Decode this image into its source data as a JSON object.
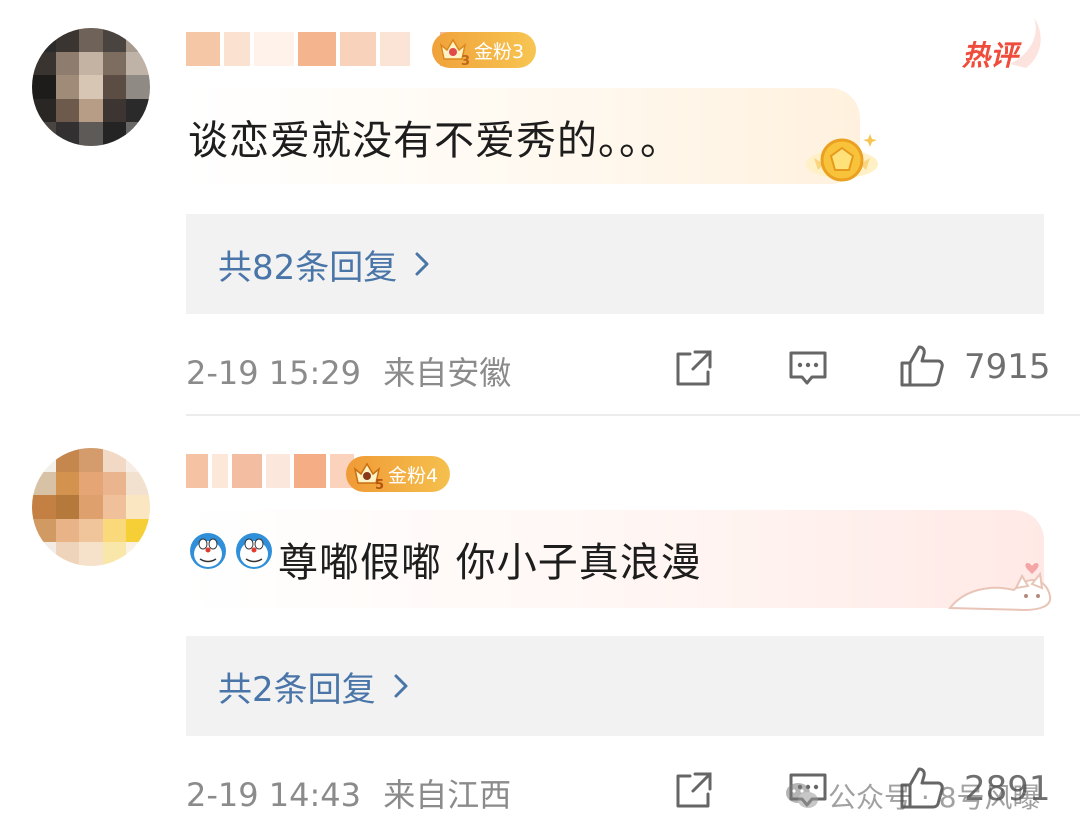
{
  "hot_label": "热评",
  "comments": [
    {
      "badge": "金粉3",
      "badge_level": "3",
      "badge_color": "#f4b740",
      "text": "谈恋爱就没有不爱秀的。。。",
      "reply_link": "共82条回复",
      "date": "2-19 15:29",
      "location": "来自安徽",
      "likes": "7915"
    },
    {
      "badge": "金粉4",
      "badge_level": "5",
      "badge_color": "#f2a53c",
      "text": "尊嘟假嘟 你小子真浪漫",
      "reply_link": "共2条回复",
      "date": "2-19 14:43",
      "location": "来自江西",
      "likes": "2891"
    }
  ],
  "watermark": "公众号 · 8号风曝",
  "icons": {
    "repost": "share-square-icon",
    "comment": "comment-bubble-icon",
    "like": "thumbs-up-icon",
    "chevron": "chevron-right-icon"
  },
  "colors": {
    "link": "#4a75a8",
    "meta": "#8b8b8b",
    "hot": "#ef4c3b"
  }
}
